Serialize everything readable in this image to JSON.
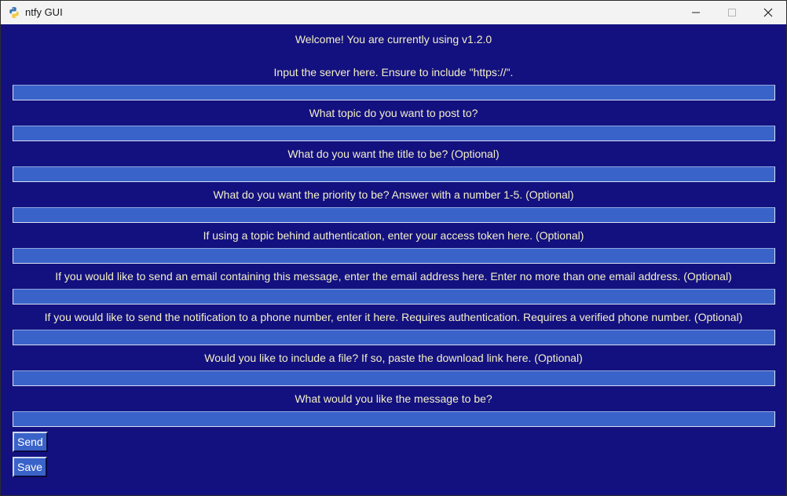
{
  "window": {
    "title": "ntfy GUI",
    "app_icon": "python-icon",
    "controls": [
      "minimize-icon",
      "maximize-icon",
      "close-icon"
    ]
  },
  "colors": {
    "background": "#13117f",
    "field": "#3a63c9",
    "label_text": "#f3efc8",
    "titlebar": "#f3f3f3"
  },
  "form": {
    "welcome": "Welcome! You are currently using v1.2.0",
    "fields": [
      {
        "label": "Input the server here. Ensure to include \"https://\".",
        "value": ""
      },
      {
        "label": "What topic do you want to post to?",
        "value": ""
      },
      {
        "label": "What do you want the title to be? (Optional)",
        "value": ""
      },
      {
        "label": "What do you want the priority to be? Answer with a number 1-5. (Optional)",
        "value": ""
      },
      {
        "label": "If using a topic behind authentication, enter your access token here. (Optional)",
        "value": ""
      },
      {
        "label": "If you would like to send an email containing this message, enter the email address here. Enter no more than one email address. (Optional)",
        "value": ""
      },
      {
        "label": "If you would like to send the notification to a phone number, enter it here. Requires authentication. Requires a verified phone number. (Optional)",
        "value": ""
      },
      {
        "label": "Would you like to include a file? If so, paste the download link here. (Optional)",
        "value": ""
      },
      {
        "label": "What would you like the message to be?",
        "value": ""
      }
    ],
    "send_label": "Send",
    "save_label": "Save"
  }
}
